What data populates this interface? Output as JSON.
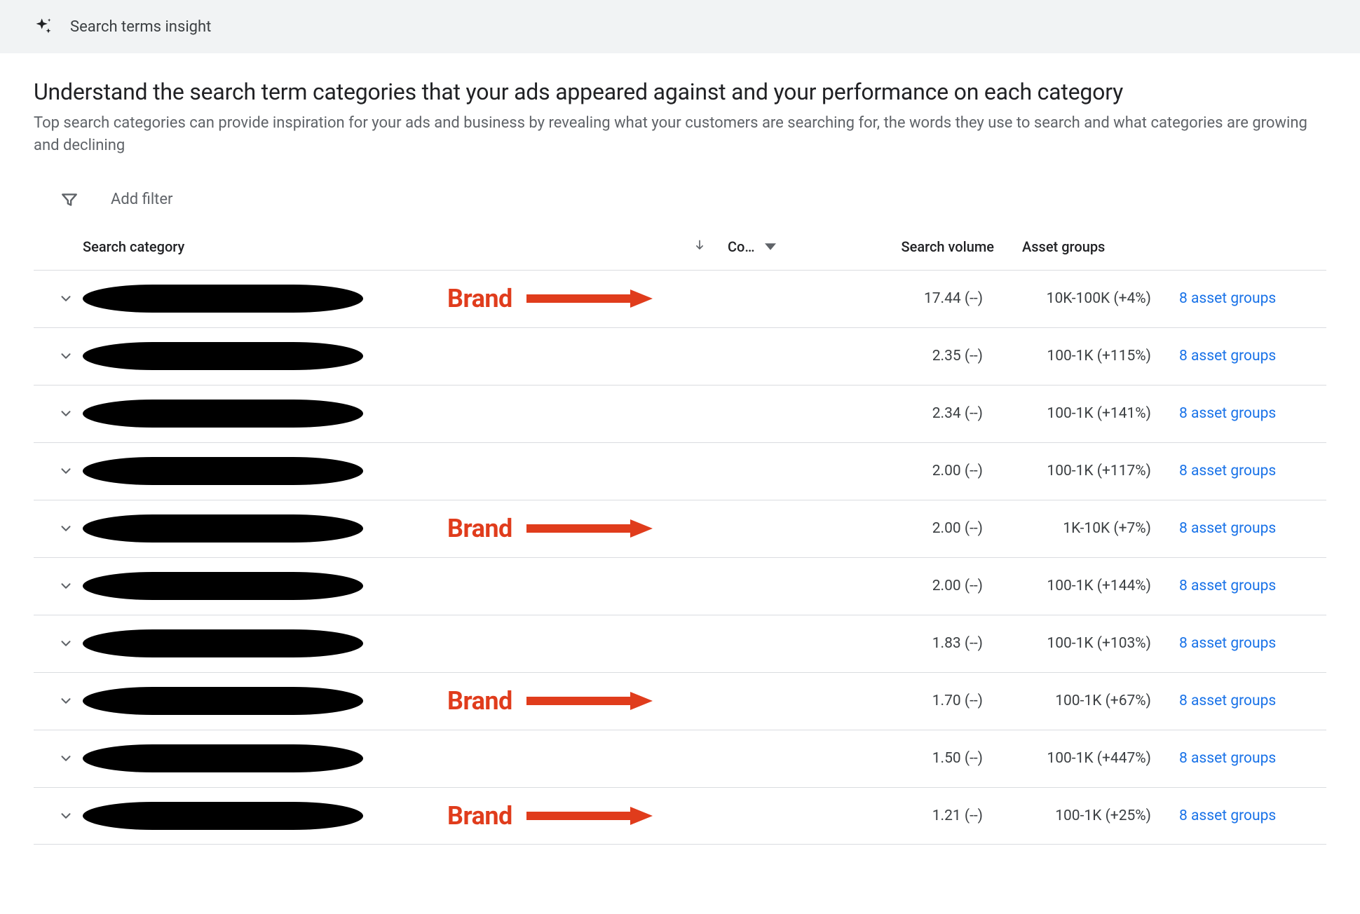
{
  "topbar": {
    "label": "Search terms insight"
  },
  "headline": "Understand the search term categories that your ads appeared against and your performance on each category",
  "subhead": "Top search categories can provide inspiration for your ads and business by revealing what your customers are searching for, the words they use to search and what categories are growing and declining",
  "filter": {
    "add_label": "Add filter"
  },
  "annotation": {
    "brand_label": "Brand"
  },
  "columns": {
    "search_category": "Search category",
    "conv_truncated": "Co…",
    "search_volume": "Search volume",
    "asset_groups": "Asset groups"
  },
  "rows": [
    {
      "brand": true,
      "conv": "17.44 (--)",
      "volume": "10K-100K (+4%)",
      "asset": "8 asset groups"
    },
    {
      "brand": false,
      "conv": "2.35 (--)",
      "volume": "100-1K (+115%)",
      "asset": "8 asset groups"
    },
    {
      "brand": false,
      "conv": "2.34 (--)",
      "volume": "100-1K (+141%)",
      "asset": "8 asset groups"
    },
    {
      "brand": false,
      "conv": "2.00 (--)",
      "volume": "100-1K (+117%)",
      "asset": "8 asset groups"
    },
    {
      "brand": true,
      "conv": "2.00 (--)",
      "volume": "1K-10K (+7%)",
      "asset": "8 asset groups"
    },
    {
      "brand": false,
      "conv": "2.00 (--)",
      "volume": "100-1K (+144%)",
      "asset": "8 asset groups"
    },
    {
      "brand": false,
      "conv": "1.83 (--)",
      "volume": "100-1K (+103%)",
      "asset": "8 asset groups"
    },
    {
      "brand": true,
      "conv": "1.70 (--)",
      "volume": "100-1K (+67%)",
      "asset": "8 asset groups"
    },
    {
      "brand": false,
      "conv": "1.50 (--)",
      "volume": "100-1K (+447%)",
      "asset": "8 asset groups"
    },
    {
      "brand": true,
      "conv": "1.21 (--)",
      "volume": "100-1K (+25%)",
      "asset": "8 asset groups"
    }
  ]
}
